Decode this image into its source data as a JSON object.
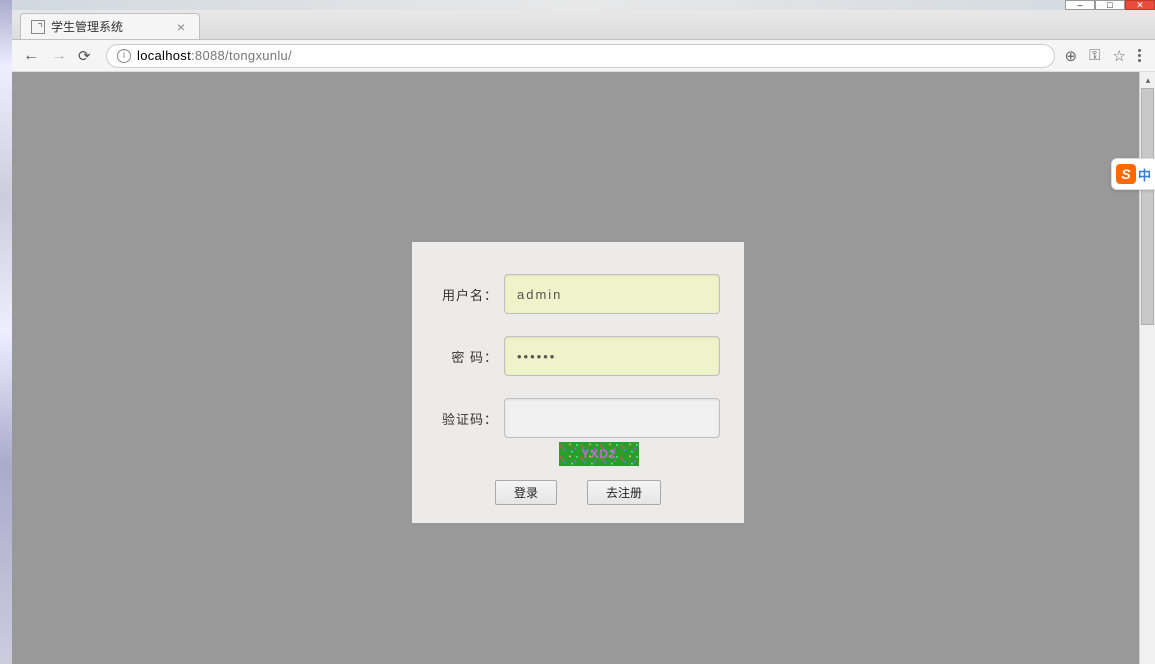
{
  "browser": {
    "tab_title": "学生管理系统",
    "url_host": "localhost",
    "url_port_path": ":8088/tongxunlu/"
  },
  "form": {
    "username_label": "用户名：",
    "username_value": "admin",
    "password_label": "密  码：",
    "password_value": "••••••",
    "captcha_label": "验证码：",
    "captcha_text": "YXD2",
    "login_button": "登录",
    "register_button": "去注册"
  },
  "ime": {
    "logo": "S",
    "lang": "中"
  }
}
